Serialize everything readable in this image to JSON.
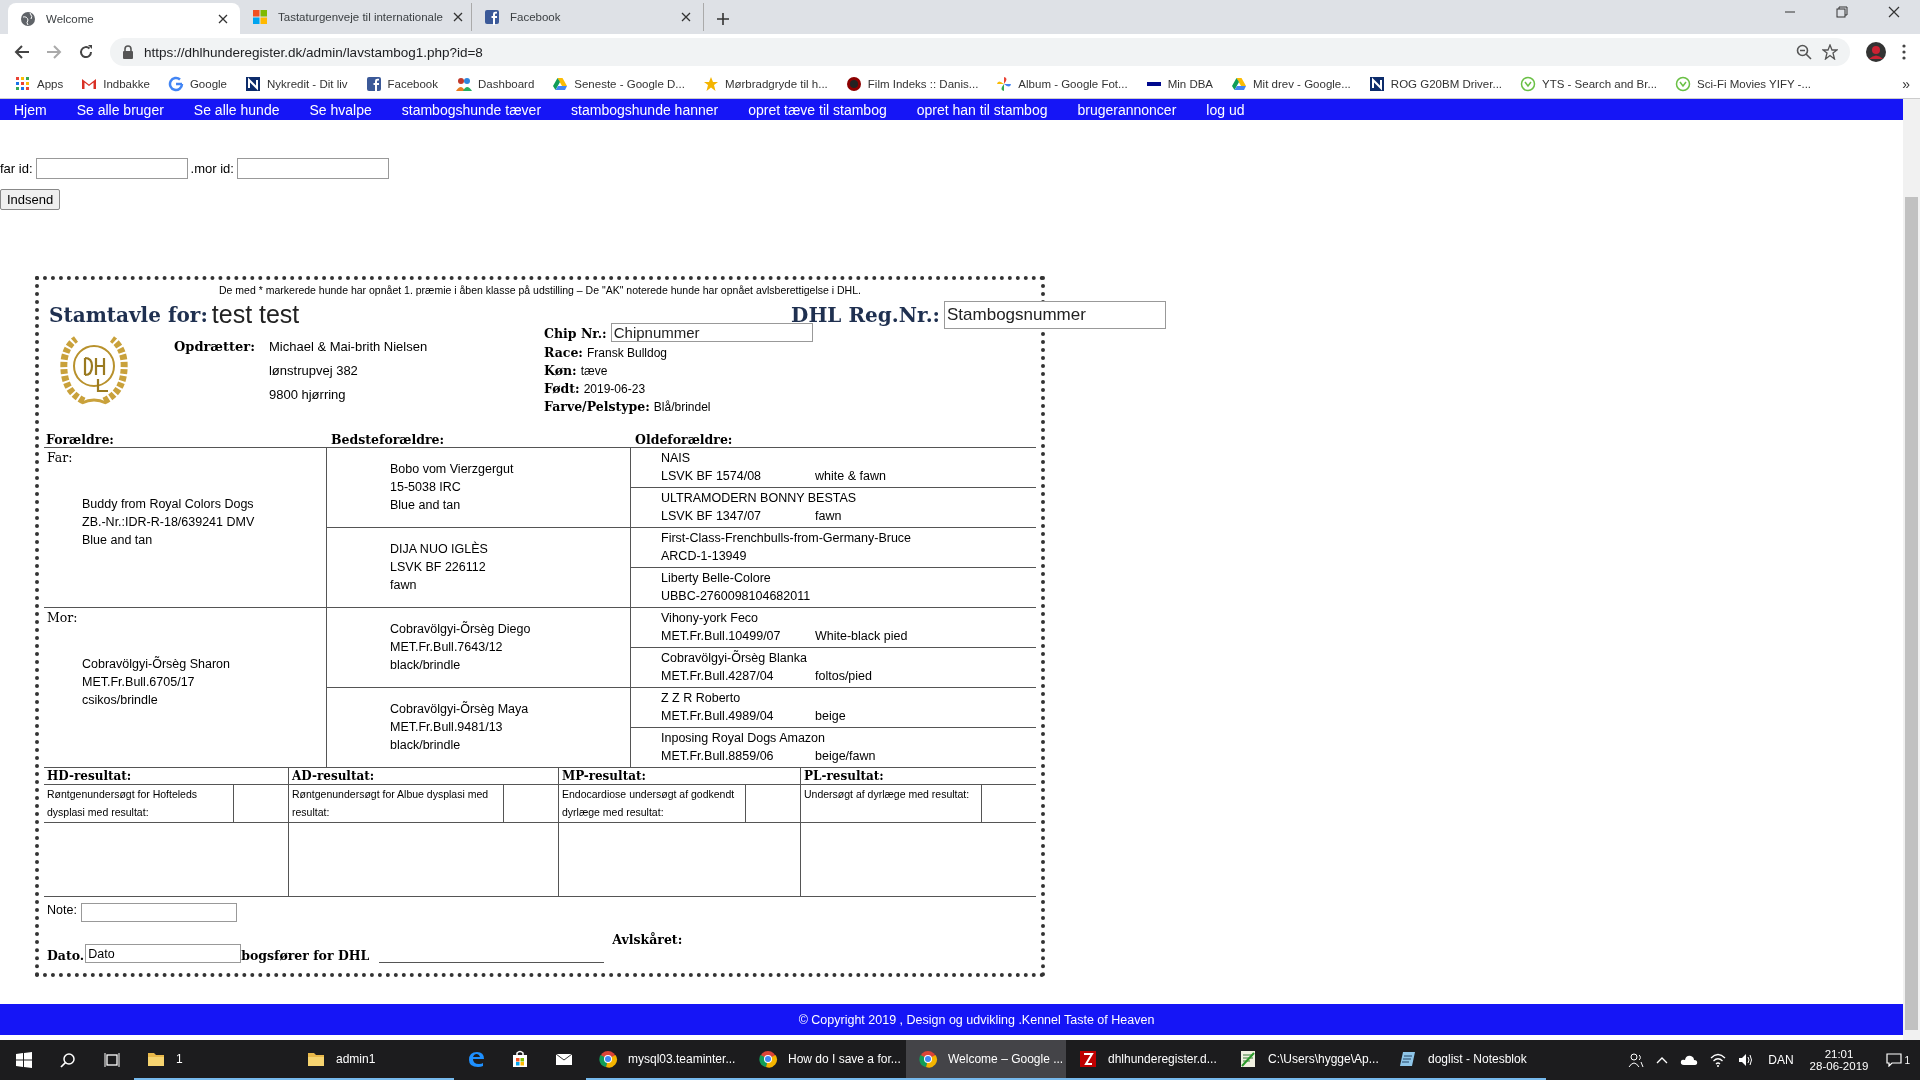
{
  "browser": {
    "tabs": [
      {
        "title": "Welcome",
        "selected": true,
        "kind": "globe"
      },
      {
        "title": "Tastaturgenveje til internationale",
        "selected": false,
        "kind": "windows"
      },
      {
        "title": "Facebook",
        "selected": false,
        "kind": "facebook"
      }
    ],
    "url": "https://dhlhunderegister.dk/admin/lavstambog1.php?id=8",
    "bookmarks": [
      {
        "label": "Apps",
        "kind": "apps"
      },
      {
        "label": "Indbakke",
        "kind": "mail"
      },
      {
        "label": "Google",
        "kind": "google"
      },
      {
        "label": "Nykredit - Dit liv",
        "kind": "square"
      },
      {
        "label": "Facebook",
        "kind": "facebook"
      },
      {
        "label": "Dashboard",
        "kind": "people"
      },
      {
        "label": "Seneste - Google D...",
        "kind": "drive"
      },
      {
        "label": "Mørbradgryde til h...",
        "kind": "star"
      },
      {
        "label": "Film Indeks :: Danis...",
        "kind": "circle"
      },
      {
        "label": "Album - Google Fot...",
        "kind": "pinwheel"
      },
      {
        "label": "Min DBA",
        "kind": "dba"
      },
      {
        "label": "Mit drev - Google...",
        "kind": "drive"
      },
      {
        "label": "ROG G20BM Driver...",
        "kind": "square"
      },
      {
        "label": "YTS - Search and Br...",
        "kind": "leaf"
      },
      {
        "label": "Sci-Fi Movies YIFY -...",
        "kind": "leaf"
      }
    ],
    "more": "»"
  },
  "nav": {
    "items": [
      "Hjem",
      "Se alle bruger",
      "Se alle hunde",
      "Se hvalpe",
      "stambogshunde tæver",
      "stambogshunde hanner",
      "opret tæve til stambog",
      "opret han til stambog",
      "brugerannoncer",
      "log ud"
    ]
  },
  "form": {
    "far_label": "far id:",
    "mor_label": ".mor id:",
    "submit": "Indsend"
  },
  "pedigree": {
    "notice": "De med * markerede hunde har opnået 1. præmie i åben klasse på udstilling – De \"AK\" noterede hunde har opnået avlsberettigelse i DHL.",
    "title_label": "Stamtavle for:",
    "title_value": "test test",
    "reg_label": "DHL Reg.Nr.:",
    "reg_value": "Stambogsnummer",
    "chip_label": "Chip Nr.:",
    "chip_value": "Chipnummer",
    "breeder_label": "Opdrætter:",
    "breeder_lines": [
      "Michael & Mai-brith Nielsen",
      "lønstrupvej 382",
      "9800 hjørring"
    ],
    "details": [
      {
        "label": "Race:",
        "value": "Fransk Bulldog"
      },
      {
        "label": "Køn:",
        "value": "tæve"
      },
      {
        "label": "Født:",
        "value": "2019-06-23"
      },
      {
        "label": "Farve/Pelstype:",
        "value": "Blå/brindel"
      }
    ],
    "headers": [
      "Forældre:",
      "Bedsteforældre:",
      "Oldeforældre:"
    ],
    "parents": [
      {
        "label": "Far:",
        "lines": [
          "Buddy from Royal Colors Dogs",
          "ZB.-Nr.:IDR-R-18/639241 DMV",
          "Blue and tan"
        ],
        "grandparents": [
          {
            "lines": [
              "Bobo vom Vierzgergut",
              "15-5038 IRC",
              "Blue and tan"
            ],
            "greatgrandparents": [
              {
                "name": "NAIS",
                "reg": "LSVK BF 1574/08",
                "coat": "white & fawn"
              },
              {
                "name": "ULTRAMODERN BONNY BESTAS",
                "reg": "LSVK BF 1347/07",
                "coat": "fawn"
              }
            ]
          },
          {
            "lines": [
              "DIJA NUO IGLÈS",
              "LSVK BF 226112",
              "fawn"
            ],
            "greatgrandparents": [
              {
                "name": "First-Class-Frenchbulls-from-Germany-Bruce",
                "reg": "ARCD-1-13949"
              },
              {
                "name": "Liberty Belle-Colore",
                "reg": "UBBC-2760098104682011"
              }
            ]
          }
        ]
      },
      {
        "label": "Mor:",
        "lines": [
          "Cobravölgyi-Õrsèg Sharon",
          "MET.Fr.Bull.6705/17",
          "csikos/brindle"
        ],
        "grandparents": [
          {
            "lines": [
              "Cobravölgyi-Õrsèg Diego",
              "MET.Fr.Bull.7643/12",
              "black/brindle"
            ],
            "greatgrandparents": [
              {
                "name": "Vihony-york Feco",
                "reg": "MET.Fr.Bull.10499/07",
                "coat": "White-black pied"
              },
              {
                "name": "Cobravölgyi-Õrsèg Blanka",
                "reg": "MET.Fr.Bull.4287/04",
                "coat": "foltos/pied"
              }
            ]
          },
          {
            "lines": [
              "Cobravölgyi-Õrsèg Maya",
              "MET.Fr.Bull.9481/13",
              "black/brindle"
            ],
            "greatgrandparents": [
              {
                "name": "Z Z R Roberto",
                "reg": "MET.Fr.Bull.4989/04",
                "coat": "beige"
              },
              {
                "name": "Inposing Royal Dogs Amazon",
                "reg": "MET.Fr.Bull.8859/06",
                "coat": "beige/fawn"
              }
            ]
          }
        ]
      }
    ],
    "results": [
      {
        "title": "HD-resultat:",
        "description": "Røntgenundersøgt for Hofteleds dysplasi med resultat:"
      },
      {
        "title": "AD-resultat:",
        "description": "Røntgenundersøgt for Albue dysplasi med resultat:"
      },
      {
        "title": "MP-resultat:",
        "description": "Endocardiose undersøgt af godkendt dyrlæge med resultat:"
      },
      {
        "title": "PL-resultat:",
        "description": "Undersøgt af dyrlæge med resultat:"
      }
    ],
    "note_label": "Note:",
    "date_label": "Dato.",
    "date_value": "Dato",
    "signature_label": "bogsfører for DHL",
    "avl_label": "Avlskåret:"
  },
  "footer": "© Copyright 2019 , Design og udvikling .Kennel Taste of Heaven",
  "taskbar": {
    "items": [
      {
        "label": "1",
        "kind": "folder",
        "selected": false
      },
      {
        "label": "admin1",
        "kind": "folder",
        "selected": false
      },
      {
        "kind": "edge",
        "selected": false
      },
      {
        "kind": "store",
        "selected": false
      },
      {
        "kind": "mail",
        "selected": false
      },
      {
        "label": "mysql03.teaminter...",
        "kind": "chrome",
        "selected": false
      },
      {
        "label": "How do I save a for...",
        "kind": "chrome",
        "selected": false
      },
      {
        "label": "Welcome – Google ...",
        "kind": "chrome",
        "selected": true
      },
      {
        "label": "dhlhunderegister.d...",
        "kind": "filezilla",
        "selected": false
      },
      {
        "label": "C:\\Users\\hygge\\Ap...",
        "kind": "editor",
        "selected": false
      },
      {
        "label": "doglist - Notesblok",
        "kind": "notepad",
        "selected": false
      }
    ],
    "language": "DAN",
    "time": "21:01",
    "date": "28-06-2019",
    "notifications": "1"
  }
}
